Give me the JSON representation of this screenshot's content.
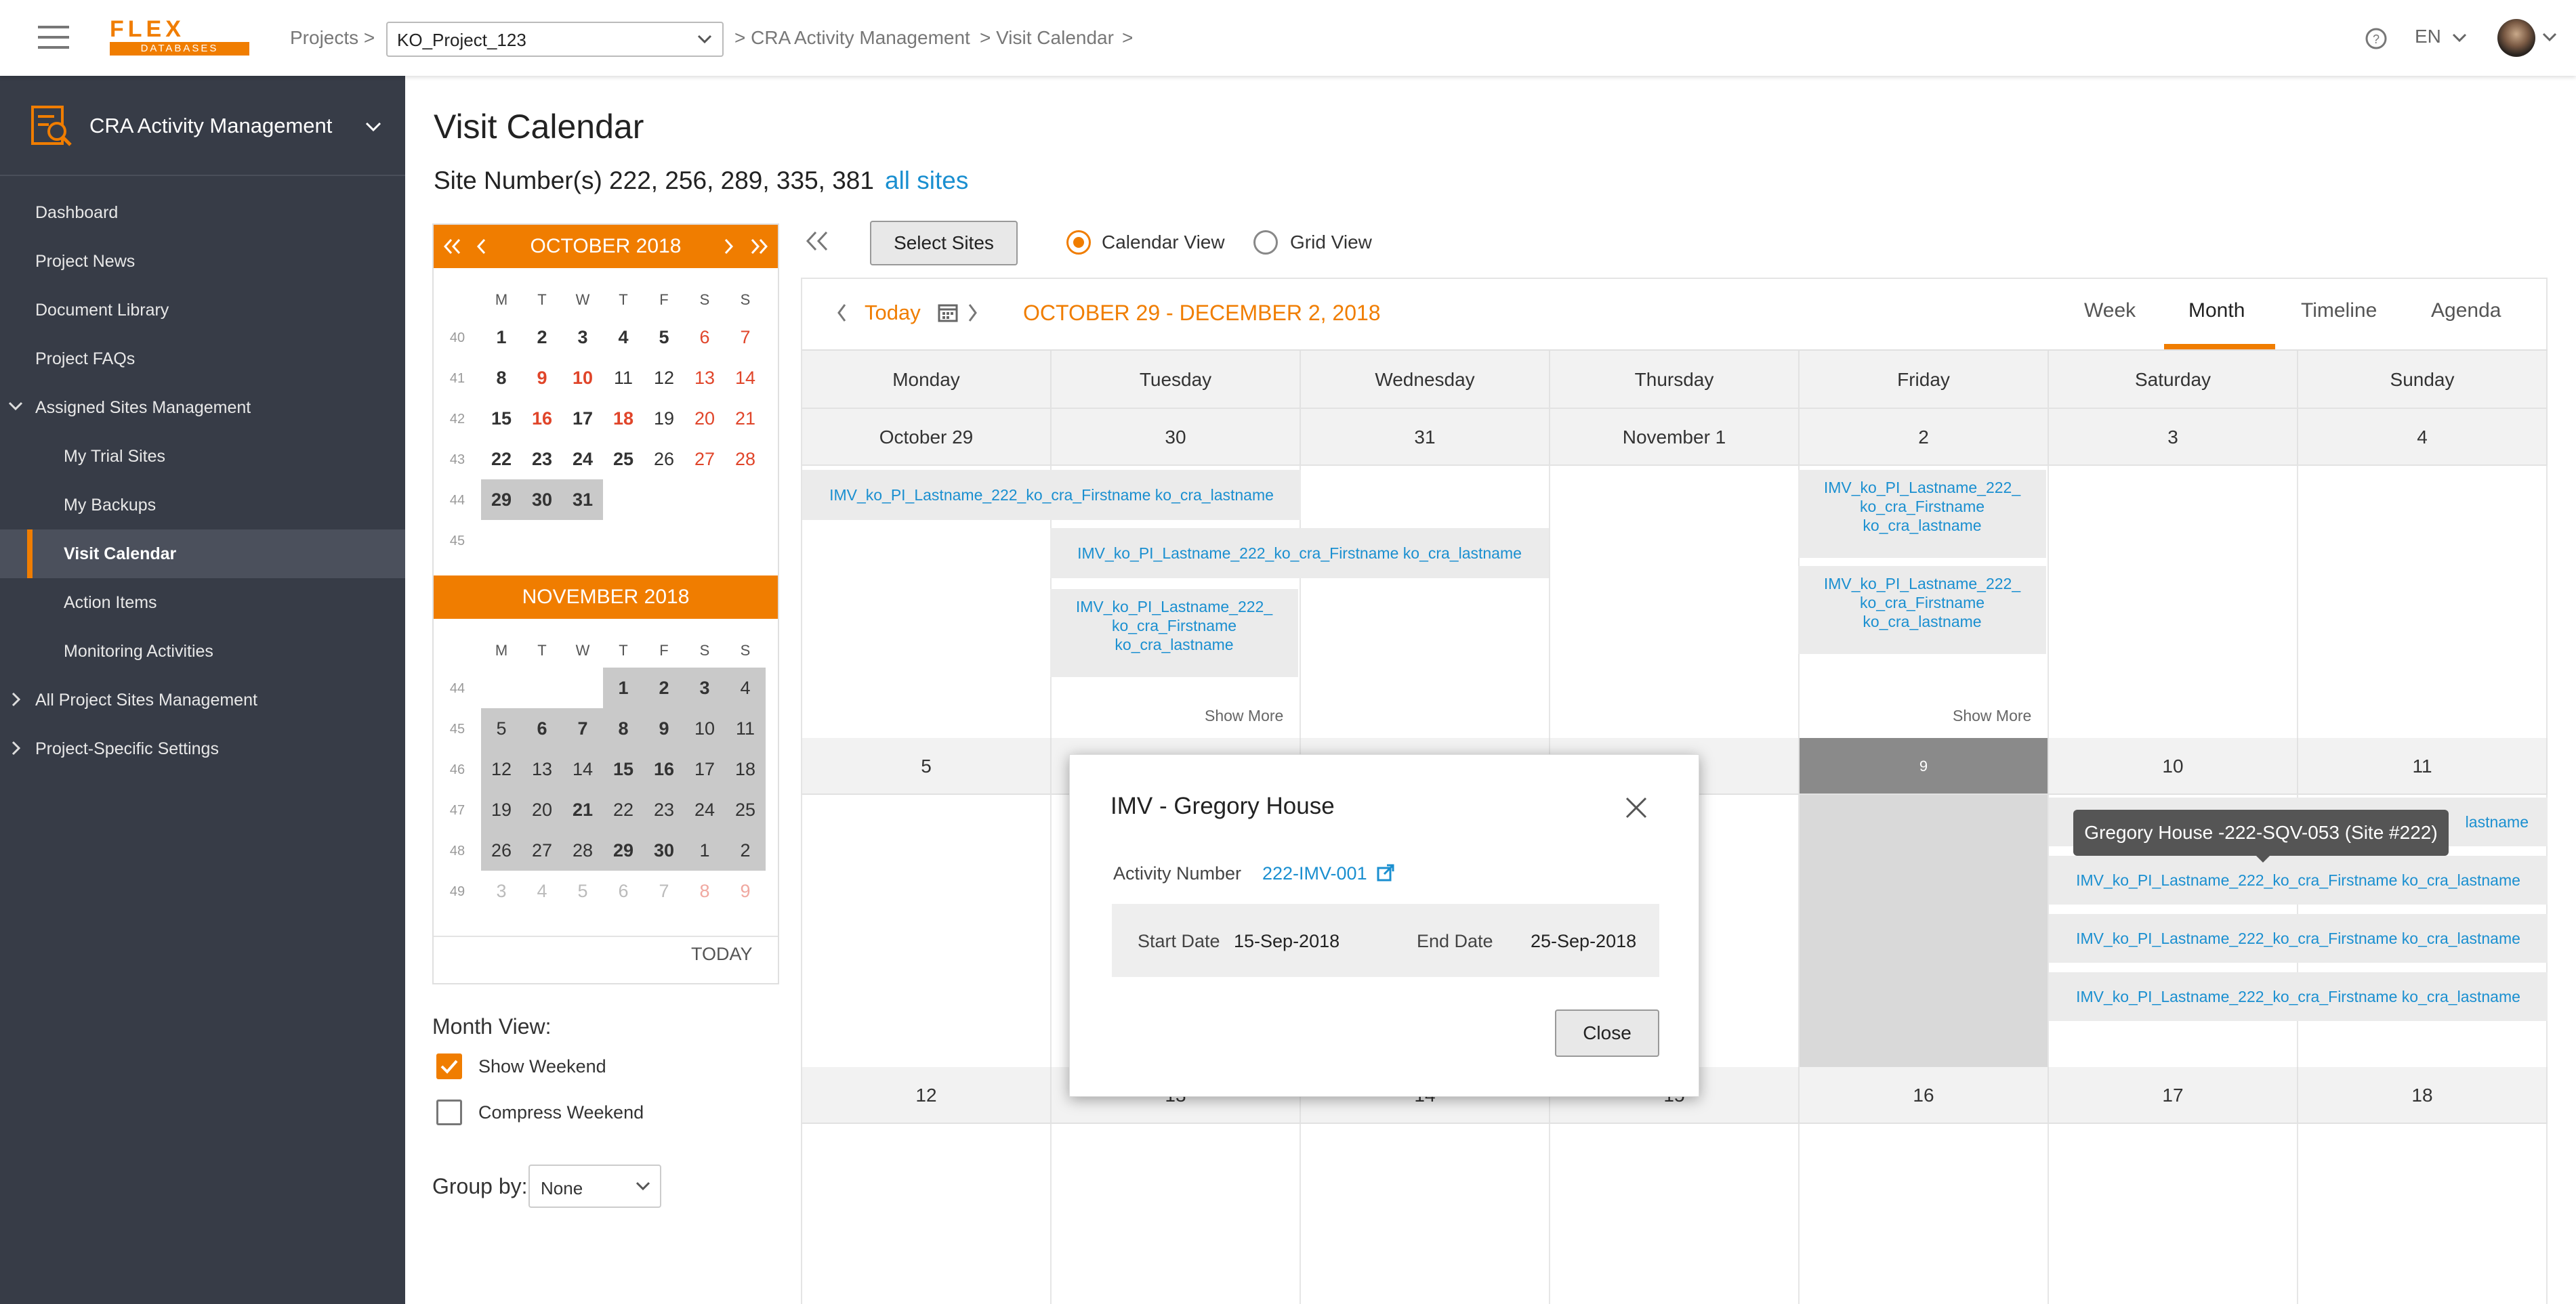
{
  "header": {
    "logo_text": "FLEX DATABASES",
    "breadcrumb_projects": "Projects >",
    "project_select": "KO_Project_123",
    "breadcrumb_module": "> CRA Activity Management",
    "breadcrumb_page": "> Visit Calendar",
    "breadcrumb_end": ">",
    "language": "EN"
  },
  "sidebar": {
    "module_title": "CRA Activity Management",
    "items": [
      {
        "label": "Dashboard"
      },
      {
        "label": "Project News"
      },
      {
        "label": "Document Library"
      },
      {
        "label": "Project FAQs"
      },
      {
        "label": "Assigned Sites Management"
      },
      {
        "label": "My Trial Sites"
      },
      {
        "label": "My Backups"
      },
      {
        "label": "Visit Calendar"
      },
      {
        "label": "Action Items"
      },
      {
        "label": "Monitoring Activities"
      },
      {
        "label": "All Project Sites Management"
      },
      {
        "label": "Project-Specific Settings"
      }
    ]
  },
  "page": {
    "title": "Visit Calendar",
    "sites_text": "Site Number(s) 222, 256, 289, 335, 381",
    "all_sites_link": "all sites"
  },
  "mini_cal": {
    "dow": [
      "M",
      "T",
      "W",
      "T",
      "F",
      "S",
      "S"
    ],
    "october": {
      "title": "OCTOBER 2018",
      "weeks": [
        "40",
        "41",
        "42",
        "43",
        "44",
        "45"
      ],
      "rows": [
        [
          "1",
          "2",
          "3",
          "4",
          "5",
          "6",
          "7"
        ],
        [
          "8",
          "9",
          "10",
          "11",
          "12",
          "13",
          "14"
        ],
        [
          "15",
          "16",
          "17",
          "18",
          "19",
          "20",
          "21"
        ],
        [
          "22",
          "23",
          "24",
          "25",
          "26",
          "27",
          "28"
        ],
        [
          "29",
          "30",
          "31",
          "",
          "",
          "",
          ""
        ],
        [
          "",
          "",
          "",
          "",
          "",
          "",
          ""
        ]
      ]
    },
    "november": {
      "title": "NOVEMBER 2018",
      "weeks": [
        "44",
        "45",
        "46",
        "47",
        "48",
        "49"
      ],
      "rows": [
        [
          "",
          "",
          "",
          "1",
          "2",
          "3",
          "4"
        ],
        [
          "5",
          "6",
          "7",
          "8",
          "9",
          "10",
          "11"
        ],
        [
          "12",
          "13",
          "14",
          "15",
          "16",
          "17",
          "18"
        ],
        [
          "19",
          "20",
          "21",
          "22",
          "23",
          "24",
          "25"
        ],
        [
          "26",
          "27",
          "28",
          "29",
          "30",
          "1",
          "2"
        ],
        [
          "3",
          "4",
          "5",
          "6",
          "7",
          "8",
          "9"
        ]
      ]
    },
    "today_label": "TODAY"
  },
  "options": {
    "month_view_label": "Month View:",
    "show_weekend": "Show Weekend",
    "compress_weekend": "Compress Weekend",
    "group_by_label": "Group by:",
    "group_by_value": "None"
  },
  "toolbar": {
    "select_sites": "Select Sites",
    "calendar_view": "Calendar View",
    "grid_view": "Grid View"
  },
  "calendar": {
    "today": "Today",
    "range": "OCTOBER 29 - DECEMBER 2, 2018",
    "tabs": [
      "Week",
      "Month",
      "Timeline",
      "Agenda"
    ],
    "days": [
      "Monday",
      "Tuesday",
      "Wednesday",
      "Thursday",
      "Friday",
      "Saturday",
      "Sunday"
    ],
    "week1": [
      "October 29",
      "30",
      "31",
      "November 1",
      "2",
      "3",
      "4"
    ],
    "week2": [
      "5",
      "",
      "",
      "",
      "9",
      "10",
      "11"
    ],
    "week3": [
      "12",
      "13",
      "14",
      "15",
      "16",
      "17",
      "18"
    ],
    "events": {
      "e1": "IMV_ko_PI_Lastname_222_ko_cra_Firstname ko_cra_lastname",
      "e2": "IMV_ko_PI_Lastname_222_ko_cra_Firstname ko_cra_lastname",
      "e3": "IMV_ko_PI_Lastname_222_ ko_cra_Firstname ko_cra_lastname",
      "e4": "IMV_ko_PI_Lastname_222_ ko_cra_Firstname ko_cra_lastname",
      "e5": "IMV_ko_PI_Lastname_222_ ko_cra_Firstname ko_cra_lastname",
      "e6": "lastname",
      "e7": "IMV_ko_PI_Lastname_222_ko_cra_Firstname ko_cra_lastname",
      "e8": "IMV_ko_PI_Lastname_222_ko_cra_Firstname ko_cra_lastname",
      "e9": "IMV_ko_PI_Lastname_222_ko_cra_Firstname ko_cra_lastname"
    },
    "show_more": "Show More"
  },
  "tooltip": "Gregory House -222-SQV-053 (Site #222)",
  "modal": {
    "title": "IMV - Gregory House",
    "activity_label": "Activity Number",
    "activity_value": "222-IMV-001",
    "start_label": "Start Date",
    "start_value": "15-Sep-2018",
    "end_label": "End Date",
    "end_value": "25-Sep-2018",
    "close_button": "Close"
  },
  "colors": {
    "accent": "#f07d00",
    "link": "#1a8fd0",
    "sidebar": "#373c47"
  }
}
